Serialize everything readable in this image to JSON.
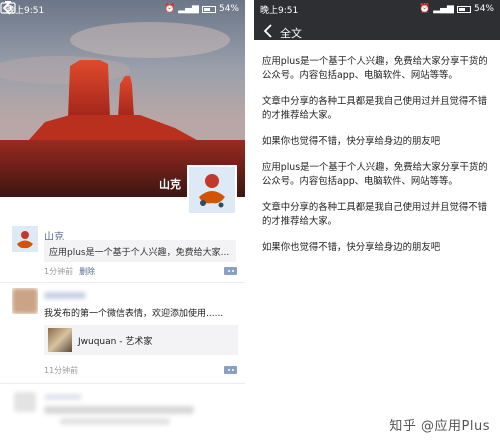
{
  "left": {
    "status_bar": {
      "time": "晚上9:51",
      "battery": "54%"
    },
    "cover": {
      "owner_name": "山克"
    },
    "post1": {
      "author": "山克",
      "share_text": "应用plus是一个基于个人兴趣，免费给大家...",
      "time": "1分钟前",
      "delete_label": "删除"
    },
    "post2": {
      "text": "我发布的第一个微信表情，欢迎添加使用......",
      "card_title": "Jwuquan - 艺术家",
      "time": "11分钟前"
    }
  },
  "right": {
    "status_bar": {
      "time": "晚上9:51",
      "battery": "54%"
    },
    "title": "全文",
    "paragraphs": [
      "应用plus是一个基于个人兴趣，免费给大家分享干货的公众号。内容包括app、电脑软件、网站等等。",
      "文章中分享的各种工具都是我自己使用过并且觉得不错的才推荐给大家。",
      "如果你也觉得不错，快分享给身边的朋友吧",
      "应用plus是一个基于个人兴趣，免费给大家分享干货的公众号。内容包括app、电脑软件、网站等等。",
      "文章中分享的各种工具都是我自己使用过并且觉得不错的才推荐给大家。",
      "如果你也觉得不错，快分享给身边的朋友吧"
    ]
  },
  "watermark": "知乎 @应用Plus",
  "colors": {
    "link": "#576b95",
    "dark_bar": "#2e2f33",
    "share_bg": "#f3f3f5"
  }
}
